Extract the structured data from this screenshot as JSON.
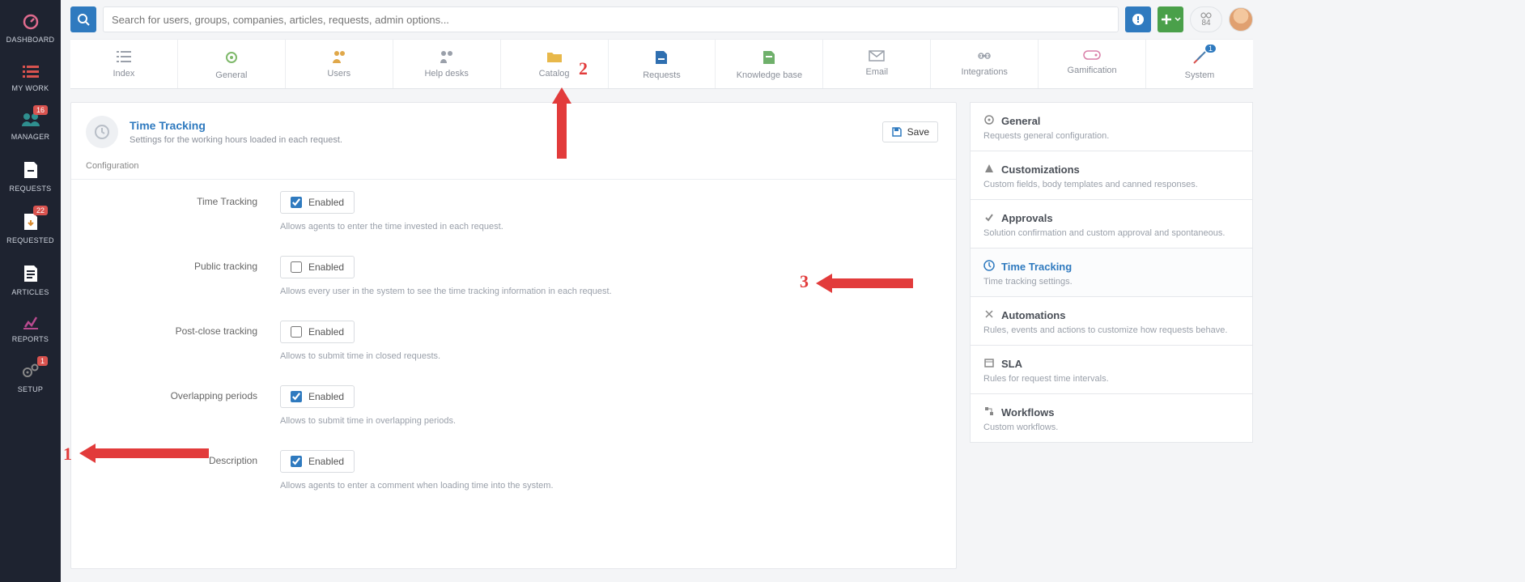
{
  "search": {
    "placeholder": "Search for users, groups, companies, articles, requests, admin options..."
  },
  "top": {
    "points": "84"
  },
  "leftnav": [
    {
      "label": "DASHBOARD",
      "badge": ""
    },
    {
      "label": "MY WORK",
      "badge": ""
    },
    {
      "label": "MANAGER",
      "badge": "16"
    },
    {
      "label": "REQUESTS",
      "badge": ""
    },
    {
      "label": "REQUESTED",
      "badge": "22"
    },
    {
      "label": "ARTICLES",
      "badge": ""
    },
    {
      "label": "REPORTS",
      "badge": ""
    },
    {
      "label": "SETUP",
      "badge": "1"
    }
  ],
  "tabs": [
    {
      "label": "Index"
    },
    {
      "label": "General"
    },
    {
      "label": "Users"
    },
    {
      "label": "Help desks"
    },
    {
      "label": "Catalog"
    },
    {
      "label": "Requests"
    },
    {
      "label": "Knowledge base"
    },
    {
      "label": "Email"
    },
    {
      "label": "Integrations"
    },
    {
      "label": "Gamification"
    },
    {
      "label": "System",
      "badge": "1"
    }
  ],
  "page": {
    "title": "Time Tracking",
    "subtitle": "Settings for the working hours loaded in each request.",
    "save": "Save",
    "section": "Configuration"
  },
  "fields": [
    {
      "label": "Time Tracking",
      "checkbox": "Enabled",
      "checked": true,
      "help": "Allows agents to enter the time invested in each request."
    },
    {
      "label": "Public tracking",
      "checkbox": "Enabled",
      "checked": false,
      "help": "Allows every user in the system to see the time tracking information in each request."
    },
    {
      "label": "Post-close tracking",
      "checkbox": "Enabled",
      "checked": false,
      "help": "Allows to submit time in closed requests."
    },
    {
      "label": "Overlapping periods",
      "checkbox": "Enabled",
      "checked": true,
      "help": "Allows to submit time in overlapping periods."
    },
    {
      "label": "Description",
      "checkbox": "Enabled",
      "checked": true,
      "help": "Allows agents to enter a comment when loading time into the system."
    }
  ],
  "sidebar": [
    {
      "title": "General",
      "desc": "Requests general configuration."
    },
    {
      "title": "Customizations",
      "desc": "Custom fields, body templates and canned responses."
    },
    {
      "title": "Approvals",
      "desc": "Solution confirmation and custom approval and spontaneous."
    },
    {
      "title": "Time Tracking",
      "desc": "Time tracking settings.",
      "active": true
    },
    {
      "title": "Automations",
      "desc": "Rules, events and actions to customize how requests behave."
    },
    {
      "title": "SLA",
      "desc": "Rules for request time intervals."
    },
    {
      "title": "Workflows",
      "desc": "Custom workflows."
    }
  ],
  "annotations": {
    "n1": "1",
    "n2": "2",
    "n3": "3"
  }
}
